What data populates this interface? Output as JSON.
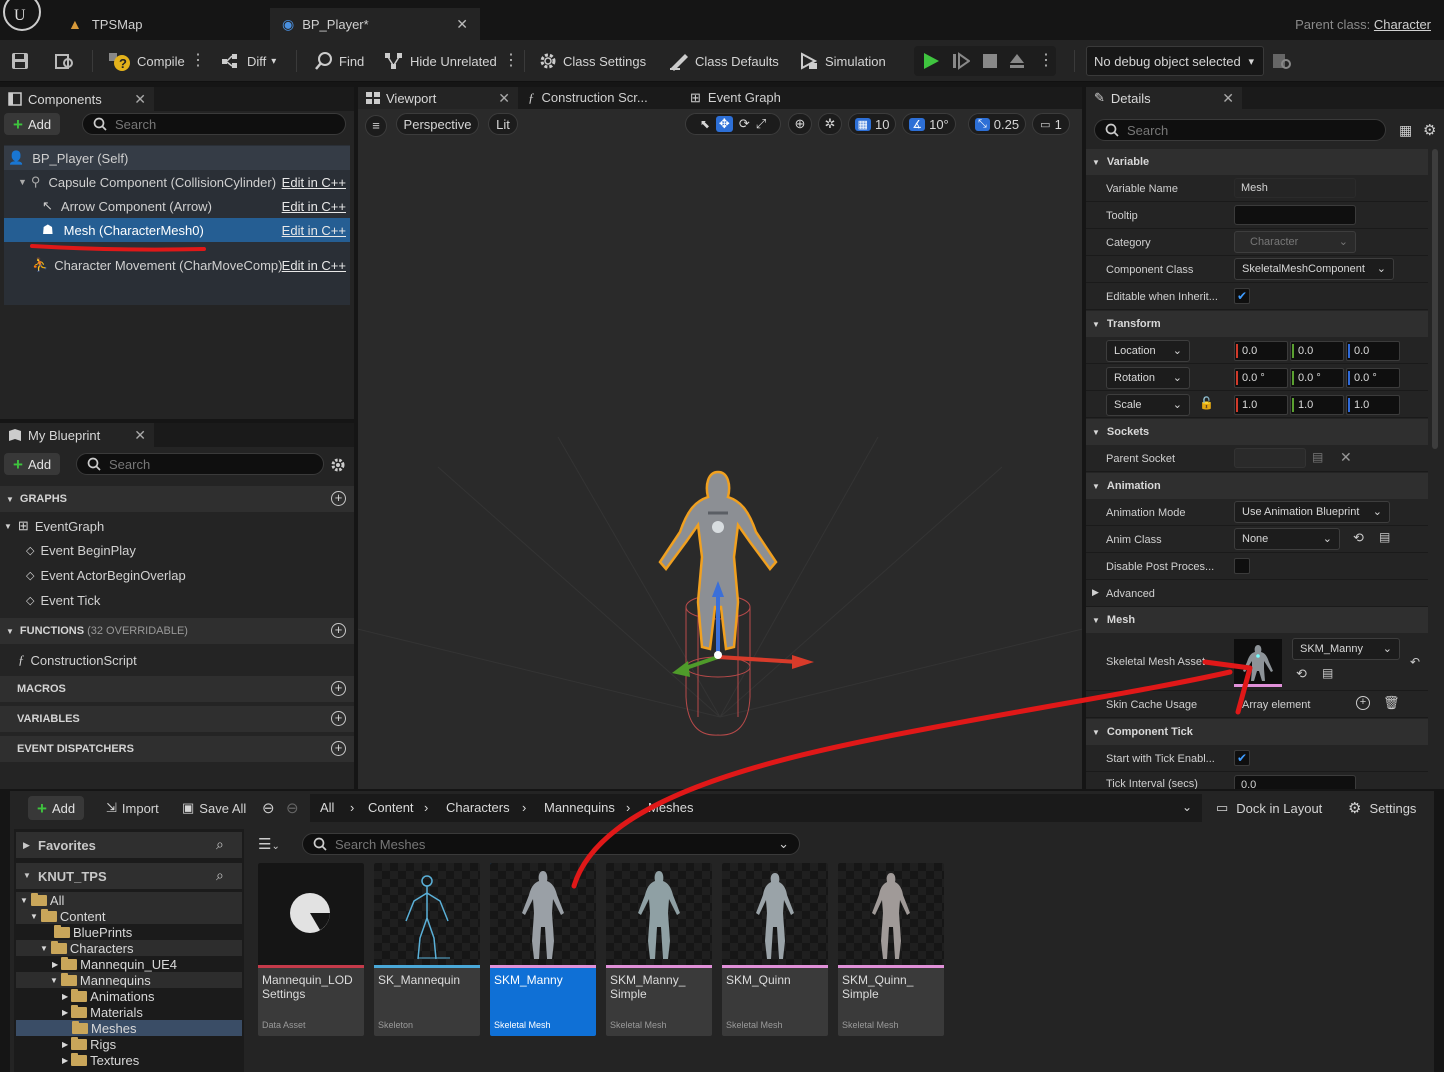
{
  "titlebar": {
    "tabs": [
      {
        "label": "TPSMap"
      },
      {
        "label": "BP_Player*"
      }
    ],
    "parent_class_label": "Parent class:",
    "parent_class_value": "Character"
  },
  "toolbar": {
    "compile": "Compile",
    "diff": "Diff",
    "find": "Find",
    "hide_unrelated": "Hide Unrelated",
    "class_settings": "Class Settings",
    "class_defaults": "Class Defaults",
    "simulation": "Simulation",
    "debug_object": "No debug object selected"
  },
  "components": {
    "tab": "Components",
    "add": "Add",
    "search_placeholder": "Search",
    "items": [
      {
        "label": "BP_Player (Self)",
        "edit": ""
      },
      {
        "label": "Capsule Component (CollisionCylinder)",
        "edit": "Edit in C++"
      },
      {
        "label": "Arrow Component (Arrow)",
        "edit": "Edit in C++"
      },
      {
        "label": "Mesh (CharacterMesh0)",
        "edit": "Edit in C++"
      },
      {
        "label": "Character Movement (CharMoveComp)",
        "edit": "Edit in C++"
      }
    ]
  },
  "my_blueprint": {
    "tab": "My Blueprint",
    "add": "Add",
    "search_placeholder": "Search",
    "graphs": "GRAPHS",
    "event_graph": "EventGraph",
    "events": [
      "Event BeginPlay",
      "Event ActorBeginOverlap",
      "Event Tick"
    ],
    "functions": "FUNCTIONS",
    "functions_note": "(32 OVERRIDABLE)",
    "construction_script": "ConstructionScript",
    "macros": "MACROS",
    "variables": "VARIABLES",
    "dispatchers": "EVENT DISPATCHERS"
  },
  "viewport": {
    "tabs": [
      {
        "label": "Viewport"
      },
      {
        "label": "Construction Scr..."
      },
      {
        "label": "Event Graph"
      }
    ],
    "perspective": "Perspective",
    "lit": "Lit",
    "grid_snap": "10",
    "rot_snap": "10°",
    "scale_snap": "0.25",
    "camera_speed": "1"
  },
  "details": {
    "tab": "Details",
    "search_placeholder": "Search",
    "variable_section": "Variable",
    "variable_name_label": "Variable Name",
    "variable_name": "Mesh",
    "tooltip_label": "Tooltip",
    "category_label": "Category",
    "category": "Character",
    "component_class_label": "Component Class",
    "component_class": "SkeletalMeshComponent",
    "editable_label": "Editable when Inherit...",
    "transform_section": "Transform",
    "location": "Location",
    "rotation": "Rotation",
    "scale": "Scale",
    "loc": [
      "0.0",
      "0.0",
      "0.0"
    ],
    "rot": [
      "0.0 °",
      "0.0 °",
      "0.0 °"
    ],
    "scl": [
      "1.0",
      "1.0",
      "1.0"
    ],
    "sockets_section": "Sockets",
    "parent_socket_label": "Parent Socket",
    "animation_section": "Animation",
    "anim_mode_label": "Animation Mode",
    "anim_mode": "Use Animation Blueprint",
    "anim_class_label": "Anim Class",
    "anim_class": "None",
    "disable_post_label": "Disable Post Proces...",
    "advanced": "Advanced",
    "mesh_section": "Mesh",
    "skeletal_mesh_label": "Skeletal Mesh Asset",
    "skeletal_mesh_value": "SKM_Manny",
    "skin_cache_label": "Skin Cache Usage",
    "array_element": "Array element",
    "component_tick_section": "Component Tick",
    "start_tick_label": "Start with Tick Enabl...",
    "tick_interval_label": "Tick Interval (secs)",
    "tick_interval": "0.0"
  },
  "content_browser": {
    "add": "Add",
    "import": "Import",
    "save_all": "Save All",
    "path": [
      "All",
      "Content",
      "Characters",
      "Mannequins",
      "Meshes"
    ],
    "dock": "Dock in Layout",
    "settings": "Settings",
    "favorites": "Favorites",
    "project": "KNUT_TPS",
    "search_placeholder": "Search Meshes",
    "tree": [
      "All",
      "Content",
      "BluePrints",
      "Characters",
      "Mannequin_UE4",
      "Mannequins",
      "Animations",
      "Materials",
      "Meshes",
      "Rigs",
      "Textures"
    ],
    "assets": [
      {
        "name": "Mannequin_LOD Settings",
        "type": "Data Asset",
        "color": "#c43a4a"
      },
      {
        "name": "SK_Mannequin",
        "type": "Skeleton",
        "color": "#4aa8d8"
      },
      {
        "name": "SKM_Manny",
        "type": "Skeletal Mesh",
        "color": "#e090d8"
      },
      {
        "name": "SKM_Manny_ Simple",
        "type": "Skeletal Mesh",
        "color": "#e090d8"
      },
      {
        "name": "SKM_Quinn",
        "type": "Skeletal Mesh",
        "color": "#e090d8"
      },
      {
        "name": "SKM_Quinn_ Simple",
        "type": "Skeletal Mesh",
        "color": "#e090d8"
      }
    ]
  }
}
